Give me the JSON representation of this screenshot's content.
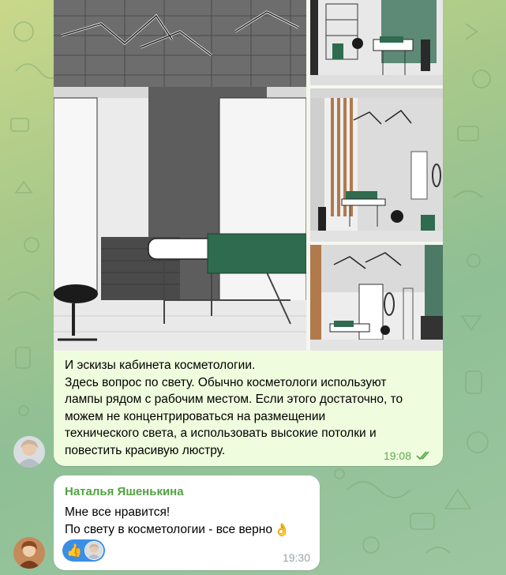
{
  "message_out": {
    "caption_lines": [
      "И эскизы кабинета косметологии.",
      "Здесь вопрос по свету. Обычно косметологи используют",
      "лампы рядом с рабочим местом. Если этого достаточно, то",
      "можем не концентрироваться на размещении",
      "технического света, а использовать высокие потолки и",
      "повестить красивую люстру."
    ],
    "time": "19:08",
    "status_icon": "double-check-icon"
  },
  "message_in": {
    "sender": "Наталья Яшенькина",
    "lines": [
      "Мне все нравится!",
      "По свету в косметологии - все верно"
    ],
    "trailing_emoji": "👌",
    "reaction_emoji": "👍",
    "time": "19:30"
  },
  "colors": {
    "outgoing_bubble": "#effdde",
    "incoming_bubble": "#ffffff",
    "sender_name": "#51a33f",
    "time_out": "#5fa84c",
    "reaction_bg": "#3a8ee6",
    "couch_green": "#2f6b4f"
  }
}
